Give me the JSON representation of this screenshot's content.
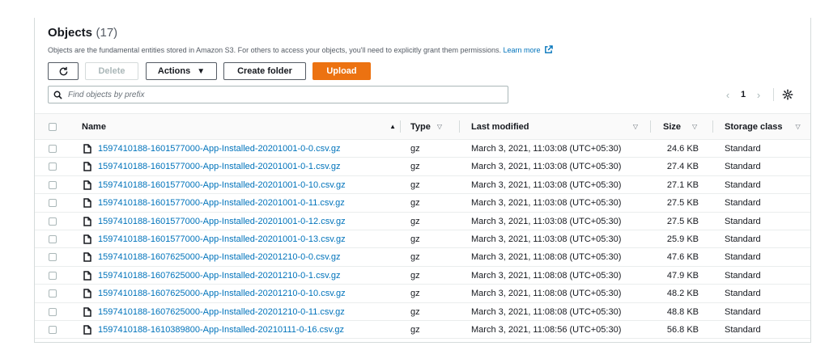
{
  "header": {
    "title": "Objects",
    "count": "(17)",
    "description": "Objects are the fundamental entities stored in Amazon S3. For others to access your objects, you'll need to explicitly grant them permissions.",
    "learn_more": "Learn more"
  },
  "toolbar": {
    "refresh_icon": "refresh-icon",
    "delete_label": "Delete",
    "actions_label": "Actions",
    "create_folder_label": "Create folder",
    "upload_label": "Upload"
  },
  "search": {
    "placeholder": "Find objects by prefix",
    "value": ""
  },
  "pagination": {
    "current_page": "1"
  },
  "colors": {
    "accent": "#ec7211",
    "link": "#0073bb"
  },
  "table": {
    "columns": {
      "name": "Name",
      "type": "Type",
      "last_modified": "Last modified",
      "size": "Size",
      "storage_class": "Storage class"
    },
    "rows": [
      {
        "name": "1597410188-1601577000-App-Installed-20201001-0-0.csv.gz",
        "type": "gz",
        "modified": "March 3, 2021, 11:03:08 (UTC+05:30)",
        "size": "24.6 KB",
        "storage": "Standard"
      },
      {
        "name": "1597410188-1601577000-App-Installed-20201001-0-1.csv.gz",
        "type": "gz",
        "modified": "March 3, 2021, 11:03:08 (UTC+05:30)",
        "size": "27.4 KB",
        "storage": "Standard"
      },
      {
        "name": "1597410188-1601577000-App-Installed-20201001-0-10.csv.gz",
        "type": "gz",
        "modified": "March 3, 2021, 11:03:08 (UTC+05:30)",
        "size": "27.1 KB",
        "storage": "Standard"
      },
      {
        "name": "1597410188-1601577000-App-Installed-20201001-0-11.csv.gz",
        "type": "gz",
        "modified": "March 3, 2021, 11:03:08 (UTC+05:30)",
        "size": "27.5 KB",
        "storage": "Standard"
      },
      {
        "name": "1597410188-1601577000-App-Installed-20201001-0-12.csv.gz",
        "type": "gz",
        "modified": "March 3, 2021, 11:03:08 (UTC+05:30)",
        "size": "27.5 KB",
        "storage": "Standard"
      },
      {
        "name": "1597410188-1601577000-App-Installed-20201001-0-13.csv.gz",
        "type": "gz",
        "modified": "March 3, 2021, 11:03:08 (UTC+05:30)",
        "size": "25.9 KB",
        "storage": "Standard"
      },
      {
        "name": "1597410188-1607625000-App-Installed-20201210-0-0.csv.gz",
        "type": "gz",
        "modified": "March 3, 2021, 11:08:08 (UTC+05:30)",
        "size": "47.6 KB",
        "storage": "Standard"
      },
      {
        "name": "1597410188-1607625000-App-Installed-20201210-0-1.csv.gz",
        "type": "gz",
        "modified": "March 3, 2021, 11:08:08 (UTC+05:30)",
        "size": "47.9 KB",
        "storage": "Standard"
      },
      {
        "name": "1597410188-1607625000-App-Installed-20201210-0-10.csv.gz",
        "type": "gz",
        "modified": "March 3, 2021, 11:08:08 (UTC+05:30)",
        "size": "48.2 KB",
        "storage": "Standard"
      },
      {
        "name": "1597410188-1607625000-App-Installed-20201210-0-11.csv.gz",
        "type": "gz",
        "modified": "March 3, 2021, 11:08:08 (UTC+05:30)",
        "size": "48.8 KB",
        "storage": "Standard"
      },
      {
        "name": "1597410188-1610389800-App-Installed-20210111-0-16.csv.gz",
        "type": "gz",
        "modified": "March 3, 2021, 11:08:56 (UTC+05:30)",
        "size": "56.8 KB",
        "storage": "Standard"
      }
    ]
  }
}
